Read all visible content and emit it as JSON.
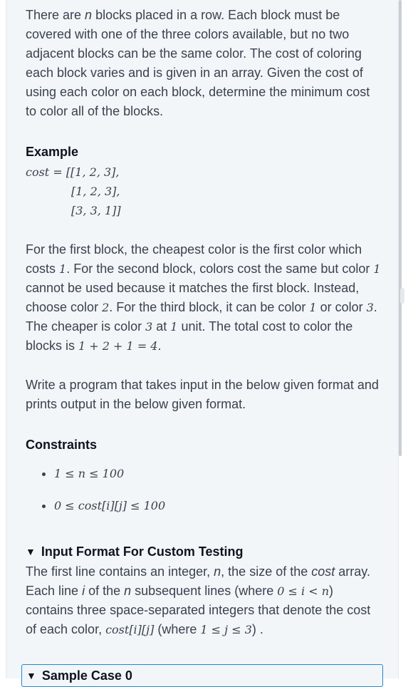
{
  "intro": {
    "part1": "There are ",
    "n": "n",
    "part2": " blocks placed in a row. Each block must be covered with one of the three colors available, but no two adjacent blocks can be the same color. The cost of coloring each block varies and is given in an array. Given the cost of using each color on each block, determine the minimum cost to color all of the blocks."
  },
  "example": {
    "heading": "Example",
    "line1": "cost = [[1, 2, 3],",
    "line2": "[1, 2, 3],",
    "line3": "[3, 3, 1]]"
  },
  "explanation": {
    "t1": "For the first block, the cheapest color is the first color which costs ",
    "v1": "1",
    "t2": ".  For the second block, colors cost the same but color ",
    "v2": "1",
    "t3": " cannot be used because it matches the first block. Instead, choose color ",
    "v3": "2",
    "t4": ".  For the third block, it can be color ",
    "v4": "1",
    "t5": " or color ",
    "v5": "3",
    "t6": ".  The cheaper is color ",
    "v6": "3",
    "t7": " at ",
    "v7": "1",
    "t8": " unit. The total cost to color the blocks is ",
    "v8": "1 + 2 + 1 = 4",
    "t9": "."
  },
  "write_program": "Write a program that takes input in the below given format and prints output in the below given format.",
  "constraints": {
    "heading": "Constraints",
    "items": [
      "1 ≤ n ≤ 100",
      "0 ≤ cost[i][j] ≤ 100"
    ]
  },
  "input_format": {
    "heading": "Input Format For Custom Testing",
    "l1a": "The first line contains an integer, ",
    "l1n": "n",
    "l1b": ", the size of the ",
    "l1c": "cost",
    "l1d": " array.",
    "l2a": "Each line ",
    "l2i": "i",
    "l2b": " of the ",
    "l2n": "n",
    "l2c": " subsequent lines (where ",
    "l2r": "0 ≤ i < n",
    "l2d": ") contains three space-separated integers that denote the cost of each color, ",
    "l2e": "cost[i][j]",
    "l2f": "  (where ",
    "l2g": "1 ≤ j ≤ 3",
    "l2h": ") ."
  },
  "sample_case": {
    "label": "Sample Case 0"
  }
}
